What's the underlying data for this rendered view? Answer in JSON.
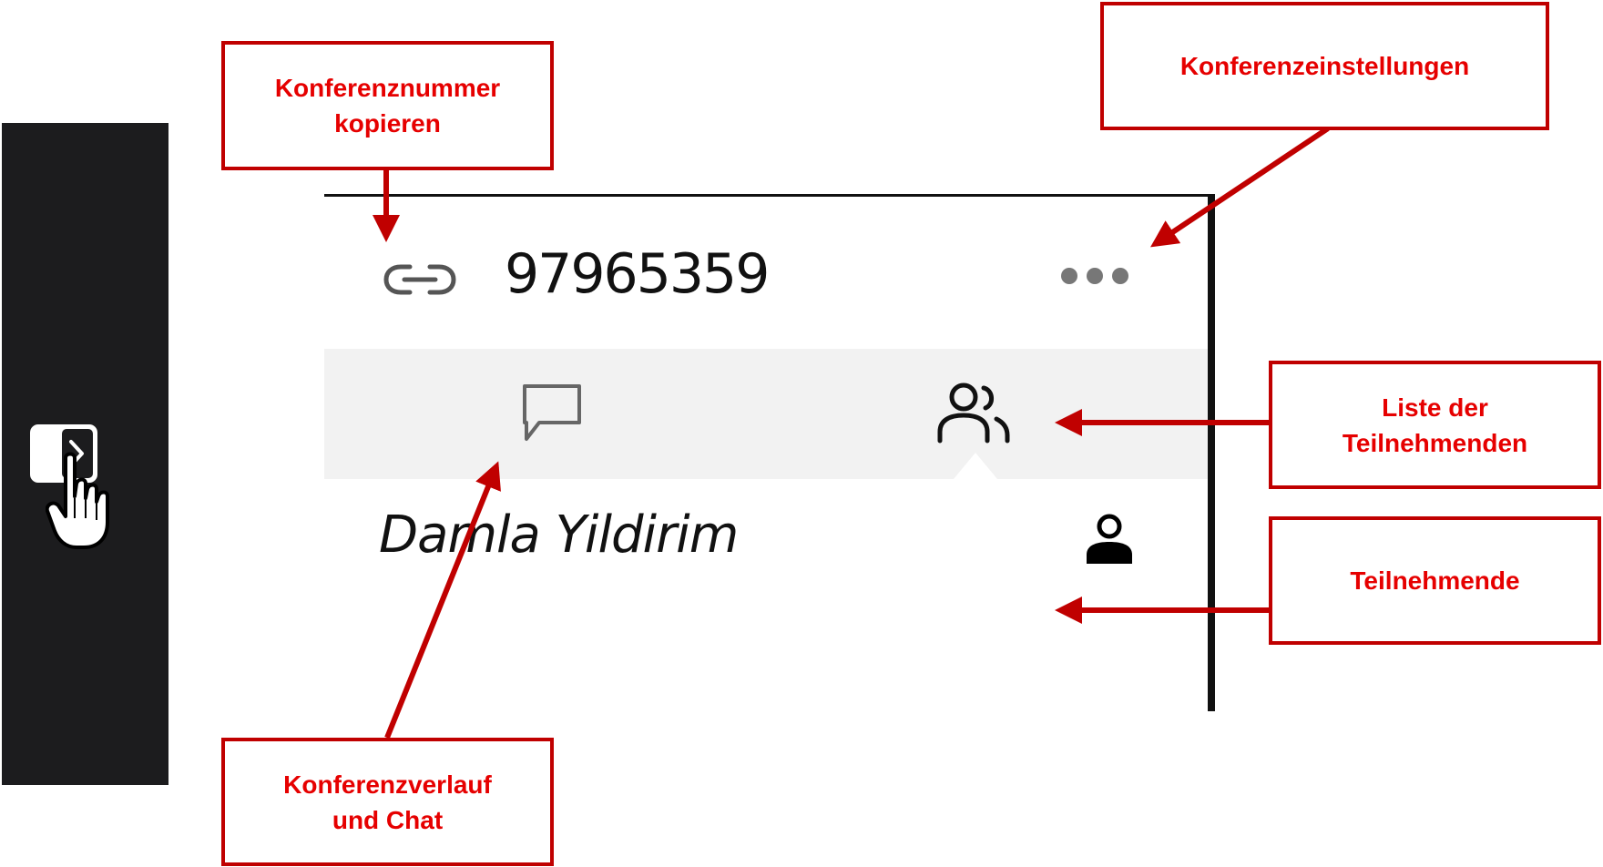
{
  "conference": {
    "number": "97965359"
  },
  "participants": [
    {
      "name": "Damla Yildirim"
    }
  ],
  "callouts": {
    "copy_number": {
      "line1": "Konferenznummer",
      "line2": "kopieren"
    },
    "settings": {
      "line1": "Konferenzeinstellungen"
    },
    "participant_list": {
      "line1": "Liste der",
      "line2": "Teilnehmenden"
    },
    "participants": {
      "line1": "Teilnehmende"
    },
    "history_chat": {
      "line1": "Konferenzverlauf",
      "line2": "und Chat"
    }
  },
  "colors": {
    "callout_border": "#c00000",
    "callout_text": "#e60000",
    "arrow": "#c00000",
    "sidebar": "#1c1c1e",
    "tabbar": "#f2f2f2"
  },
  "icons": [
    "panel-toggle-icon",
    "pointer-hand-icon",
    "link-icon",
    "more-icon",
    "chat-icon",
    "people-icon",
    "person-icon"
  ]
}
